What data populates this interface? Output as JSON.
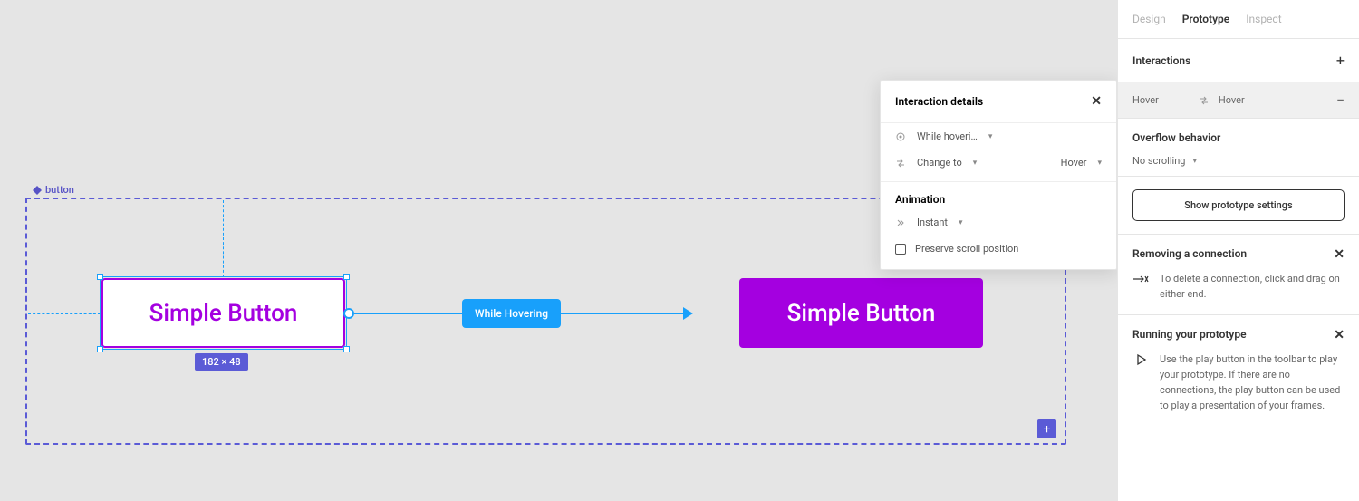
{
  "canvas": {
    "frame_label": "button",
    "btn1_text": "Simple Button",
    "btn2_text": "Simple Button",
    "dimensions": "182 × 48",
    "connection_badge": "While Hovering",
    "plus": "+"
  },
  "popover": {
    "title": "Interaction details",
    "trigger_label": "While hoveri…",
    "action_label": "Change to",
    "action_target": "Hover",
    "animation_heading": "Animation",
    "animation_type": "Instant",
    "preserve_scroll": "Preserve scroll position"
  },
  "sidebar": {
    "tabs": {
      "design": "Design",
      "prototype": "Prototype",
      "inspect": "Inspect"
    },
    "interactions_heading": "Interactions",
    "interaction_row": {
      "trigger": "Hover",
      "target": "Hover"
    },
    "overflow_heading": "Overflow behavior",
    "overflow_value": "No scrolling",
    "show_settings": "Show prototype settings",
    "help1": {
      "heading": "Removing a connection",
      "body": "To delete a connection, click and drag on either end."
    },
    "help2": {
      "heading": "Running your prototype",
      "body": "Use the play button in the toolbar to play your prototype. If there are no connections, the play button can be used to play a presentation of your frames."
    }
  }
}
